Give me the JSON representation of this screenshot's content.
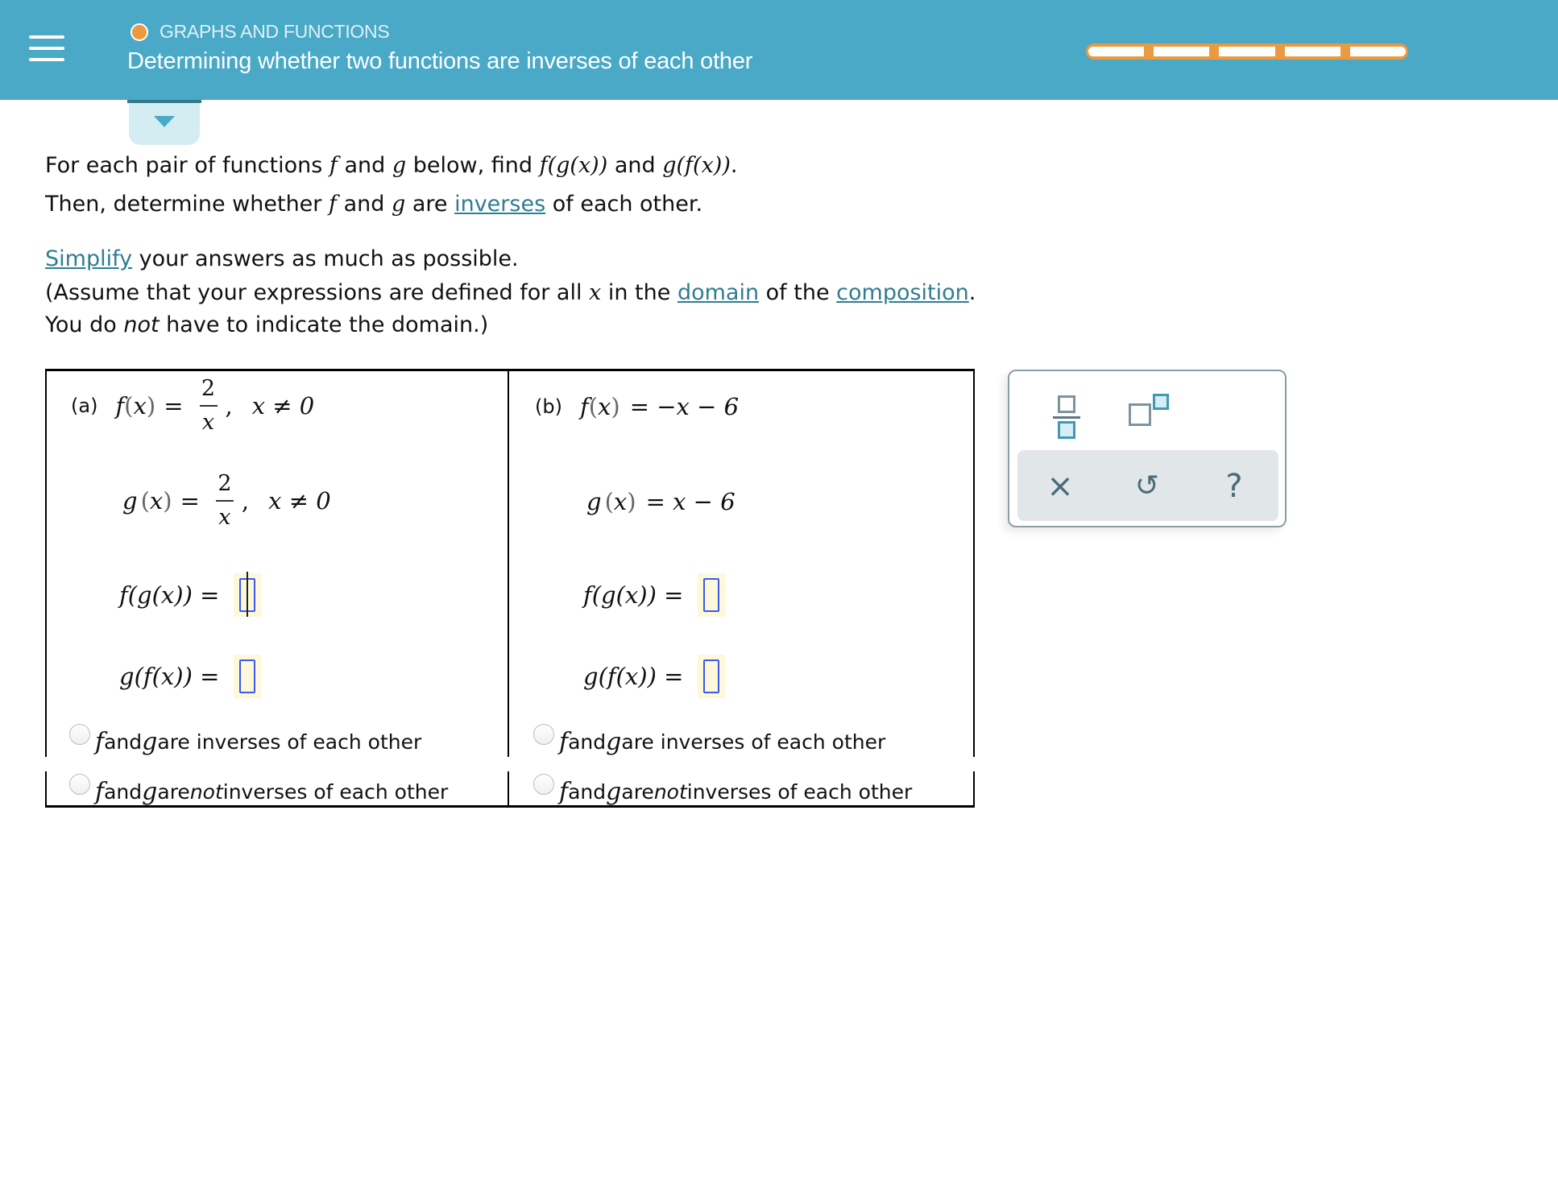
{
  "header": {
    "menu_icon": "hamburger-icon",
    "topic": "GRAPHS AND FUNCTIONS",
    "topic_status_color": "#ec9a40",
    "title": "Determining whether two functions are inverses of each other",
    "progress": {
      "segments_total": 5,
      "color": "#ec9a40",
      "background": "#49a9c6"
    },
    "toggle_icon": "caret-down-icon"
  },
  "instructions": {
    "line1": {
      "a": "For each pair of functions ",
      "f": "f",
      "b": " and ",
      "g": "g",
      "c": " below, find ",
      "fg": "f(g(x))",
      "d": " and ",
      "gf": "g(f(x))",
      "e": "."
    },
    "line2": {
      "a": "Then, determine whether ",
      "f": "f",
      "b": " and ",
      "g": "g",
      "c": " are ",
      "link": "inverses",
      "d": " of each other."
    },
    "line3": {
      "link": "Simplify",
      "a": " your answers as much as possible."
    },
    "line4": {
      "a": "(Assume that your expressions are defined for all ",
      "x": "x",
      "b": " in the ",
      "link1": "domain",
      "c": " of the ",
      "link2": "composition",
      "d": "."
    },
    "line5": {
      "a": "You do ",
      "em": "not",
      "b": " have to indicate the domain.)"
    }
  },
  "parts": [
    {
      "label": "(a)",
      "f_lhs": "f",
      "f_arg": "x",
      "f_rhs_num": "2",
      "f_rhs_den": "x",
      "f_cond": "x ≠ 0",
      "g_lhs": "g",
      "g_arg": "x",
      "g_rhs_num": "2",
      "g_rhs_den": "x",
      "g_cond": "x ≠ 0",
      "fg_label": "f(g(x)) =",
      "fg_value": "",
      "gf_label": "g(f(x)) =",
      "gf_value": "",
      "option_inverse": {
        "f": "f",
        "and": " and ",
        "g": "g",
        "rest": " are inverses of each other",
        "selected": false
      },
      "option_not_inverse": {
        "f": "f",
        "and": " and ",
        "g": "g",
        "are": " are ",
        "em": "not",
        "rest": " inverses of each other",
        "selected": false
      }
    },
    {
      "label": "(b)",
      "f_lhs": "f",
      "f_arg": "x",
      "f_rhs": "= −x − 6",
      "g_lhs": "g",
      "g_arg": "x",
      "g_rhs": "= x − 6",
      "fg_label": "f(g(x)) =",
      "fg_value": "",
      "gf_label": "g(f(x)) =",
      "gf_value": "",
      "option_inverse": {
        "f": "f",
        "and": " and ",
        "g": "g",
        "rest": " are inverses of each other",
        "selected": false
      },
      "option_not_inverse": {
        "f": "f",
        "and": " and ",
        "g": "g",
        "are": " are ",
        "em": "not",
        "rest": " inverses of each other",
        "selected": false
      }
    }
  ],
  "palette": {
    "buttons": [
      "fraction-icon",
      "exponent-icon"
    ],
    "actions": [
      {
        "name": "clear",
        "glyph": "×"
      },
      {
        "name": "undo",
        "glyph": "↺"
      },
      {
        "name": "help",
        "glyph": "?"
      }
    ]
  }
}
